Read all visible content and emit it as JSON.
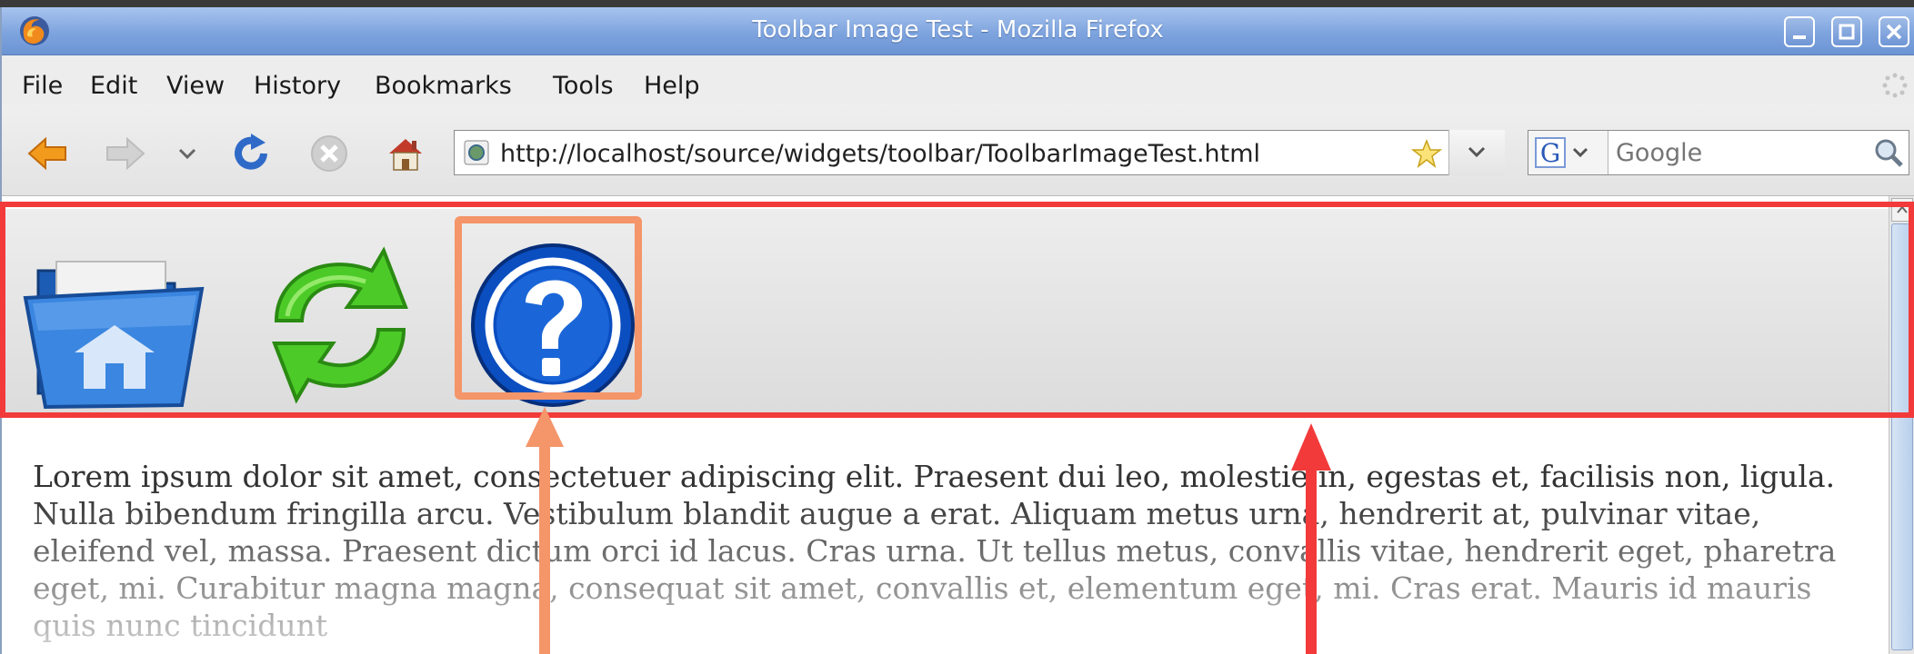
{
  "window": {
    "title": "Toolbar Image Test - Mozilla Firefox"
  },
  "menu": {
    "file": "File",
    "edit": "Edit",
    "view": "View",
    "history": "History",
    "bookmarks": "Bookmarks",
    "tools": "Tools",
    "help": "Help"
  },
  "navigation": {
    "url": "http://localhost/source/widgets/toolbar/ToolbarImageTest.html",
    "search_placeholder": "Google",
    "search_engine": "G"
  },
  "toolbar": {
    "buttons": [
      {
        "icon": "home-folder-icon"
      },
      {
        "icon": "refresh-icon"
      },
      {
        "icon": "help-icon"
      }
    ]
  },
  "content": {
    "lorem": "Lorem ipsum dolor sit amet, consectetuer adipiscing elit. Praesent dui leo, molestie in, egestas et, facilisis non, ligula. Nulla bibendum fringilla arcu. Vestibulum blandit augue a erat. Aliquam metus urna, hendrerit at, pulvinar vitae, eleifend vel, massa. Praesent dictum orci id lacus. Cras urna. Ut tellus metus, convallis vitae, hendrerit eget, pharetra eget, mi. Curabitur magna magna, consequat sit amet, convallis et, elementum eget, mi. Cras erat. Mauris id mauris quis nunc tincidunt"
  },
  "colors": {
    "highlight_toolbar": "#f23a3a",
    "highlight_help_button": "#f4956a",
    "titlebar": "#7ea4de"
  }
}
